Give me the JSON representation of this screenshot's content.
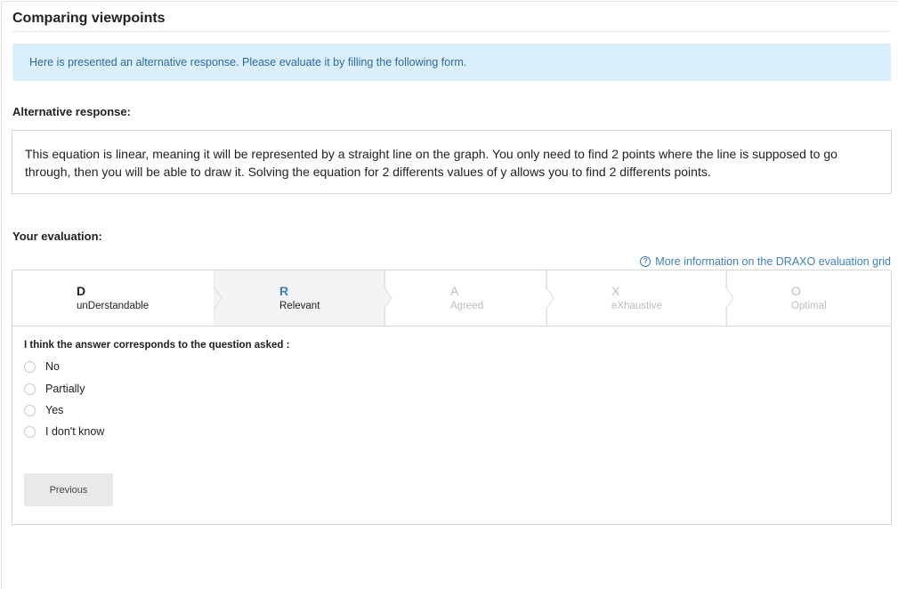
{
  "header": {
    "title": "Comparing viewpoints"
  },
  "info_banner": {
    "text": "Here is presented an alternative response. Please evaluate it by filling the following form."
  },
  "alternative_response": {
    "label": "Alternative response:",
    "text": "This equation is linear, meaning it will be represented by a straight line on the graph. You only need to find 2 points where the line is supposed to go through, then you will be able to draw it. Solving the equation for 2 differents values of y allows you to find 2 differents points."
  },
  "evaluation": {
    "label": "Your evaluation:",
    "more_info_link": "More information on the DRAXO evaluation grid",
    "help_icon": "question-circle-icon",
    "steps": [
      {
        "letter": "D",
        "name": "unDerstandable",
        "state": "done"
      },
      {
        "letter": "R",
        "name": "Relevant",
        "state": "active"
      },
      {
        "letter": "A",
        "name": "Agreed",
        "state": "pending"
      },
      {
        "letter": "X",
        "name": "eXhaustive",
        "state": "pending"
      },
      {
        "letter": "O",
        "name": "Optimal",
        "state": "pending"
      }
    ],
    "question": "I think the answer corresponds to the question asked :",
    "options": [
      "No",
      "Partially",
      "Yes",
      "I don't know"
    ],
    "selected_option": null,
    "previous_button": "Previous"
  },
  "colors": {
    "accent": "#3d7fc1",
    "info_background": "#dbeefc",
    "info_text": "#2c6aa0",
    "active_step_background": "#f2f3f5",
    "pending_text": "#bdbdbd"
  }
}
